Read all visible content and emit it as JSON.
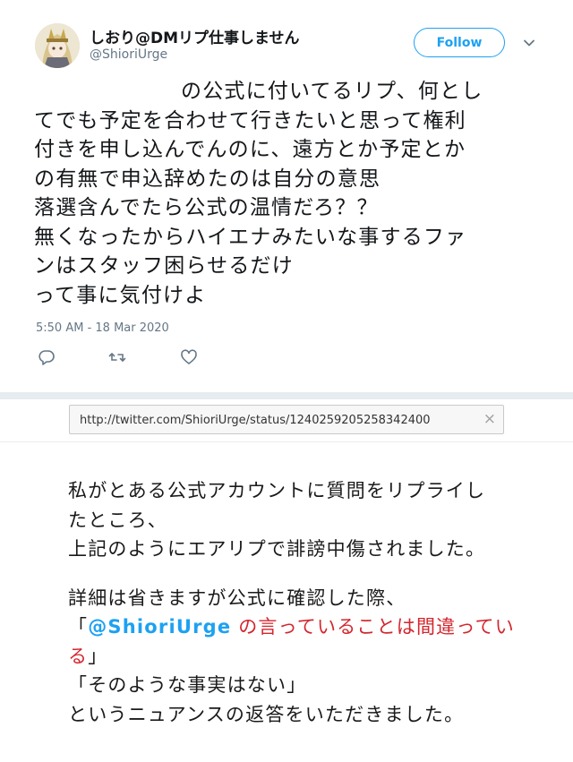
{
  "tweet": {
    "display_name": "しおり@DMリプ仕事しません",
    "handle": "@ShioriUrge",
    "follow_label": "Follow",
    "text_lines": [
      "の公式に付いてるリプ、何とし",
      "てでも予定を合わせて行きたいと思って権利",
      "付きを申し込んでんのに、遠方とか予定とか",
      "の有無で申込辞めたのは自分の意思",
      "落選含んでたら公式の温情だろ？？",
      "無くなったからハイエナみたいな事するファ",
      "ンはスタッフ困らせるだけ",
      "って事に気付けよ"
    ],
    "timestamp": "5:50 AM - 18 Mar 2020",
    "actions": [
      "reply-icon",
      "retweet-icon",
      "like-icon"
    ]
  },
  "url_bar": {
    "url": "http://twitter.com/ShioriUrge/status/1240259205258342400",
    "close_glyph": "×"
  },
  "note": {
    "line1": "私がとある公式アカウントに質問をリプライし",
    "line2": "たところ、",
    "line3": "上記のようにエアリプで誹謗中傷されました。",
    "line4": "詳細は省きますが公式に確認した際、",
    "quote_open": "「",
    "mention": "@ShioriUrge",
    "quote_red_1": " の言っていることは間違ってい",
    "quote_red_2": "る",
    "quote_close": "」",
    "line6": "「そのような事実はない」",
    "line7": "というニュアンスの返答をいただきました。"
  },
  "colors": {
    "accent": "#1da1f2",
    "highlight_red": "#d3262d",
    "muted": "#657786"
  }
}
